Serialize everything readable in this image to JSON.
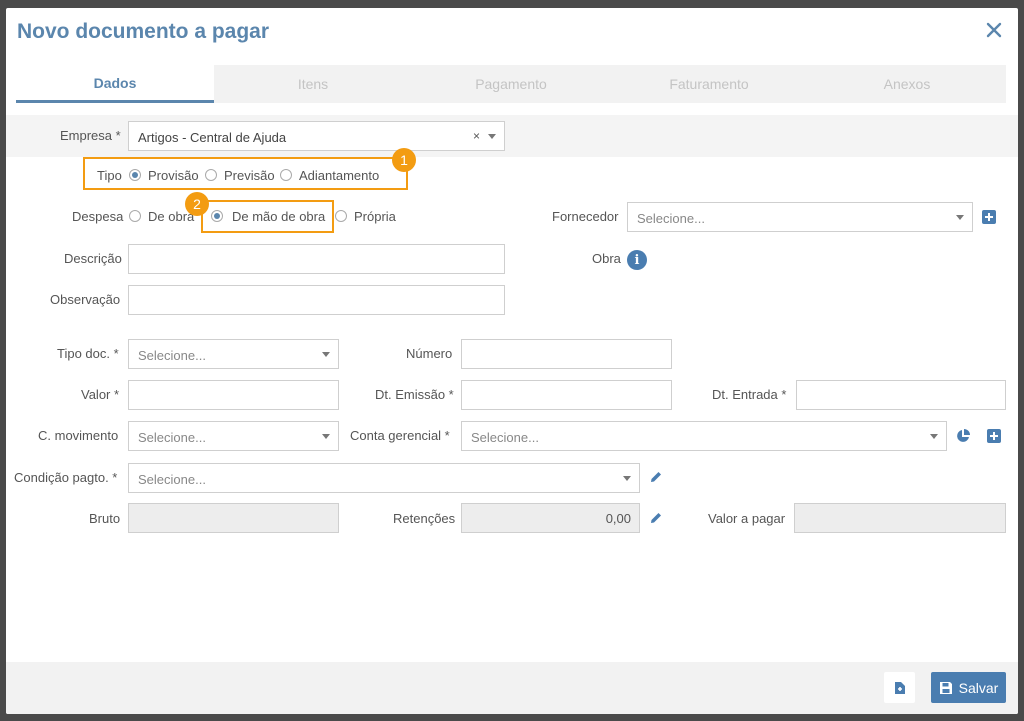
{
  "modal": {
    "title": "Novo documento a pagar"
  },
  "tabs": [
    {
      "label": "Dados",
      "active": true
    },
    {
      "label": "Itens"
    },
    {
      "label": "Pagamento"
    },
    {
      "label": "Faturamento"
    },
    {
      "label": "Anexos"
    }
  ],
  "form": {
    "empresa": {
      "label": "Empresa *",
      "value": "Artigos - Central de Ajuda",
      "clear": "×"
    },
    "tipo": {
      "label": "Tipo",
      "options": [
        "Provisão",
        "Previsão",
        "Adiantamento"
      ],
      "selected": "Provisão"
    },
    "despesa": {
      "label": "Despesa",
      "options": [
        "De obra",
        "De mão de obra",
        "Própria"
      ],
      "selected": "De mão de obra"
    },
    "fornecedor": {
      "label": "Fornecedor",
      "placeholder": "Selecione..."
    },
    "descricao": {
      "label": "Descrição",
      "value": ""
    },
    "obra": {
      "label": "Obra",
      "info": "i"
    },
    "observacao": {
      "label": "Observação",
      "value": ""
    },
    "tipo_doc": {
      "label": "Tipo doc. *",
      "placeholder": "Selecione..."
    },
    "numero": {
      "label": "Número",
      "value": ""
    },
    "valor": {
      "label": "Valor *",
      "value": ""
    },
    "dt_emissao": {
      "label": "Dt. Emissão *",
      "value": ""
    },
    "dt_entrada": {
      "label": "Dt. Entrada *",
      "value": ""
    },
    "c_movimento": {
      "label": "C. movimento",
      "placeholder": "Selecione..."
    },
    "conta_gerencial": {
      "label": "Conta gerencial *",
      "placeholder": "Selecione..."
    },
    "condicao_pagto": {
      "label": "Condição pagto. *",
      "placeholder": "Selecione..."
    },
    "bruto": {
      "label": "Bruto",
      "value": ""
    },
    "retencoes": {
      "label": "Retenções",
      "value": "0,00"
    },
    "valor_a_pagar": {
      "label": "Valor a pagar",
      "value": ""
    }
  },
  "annotations": [
    "1",
    "2"
  ],
  "footer": {
    "save_label": "Salvar"
  },
  "colors": {
    "accent": "#5b86ad",
    "highlight": "#f39c12",
    "button": "#4a7db0"
  }
}
